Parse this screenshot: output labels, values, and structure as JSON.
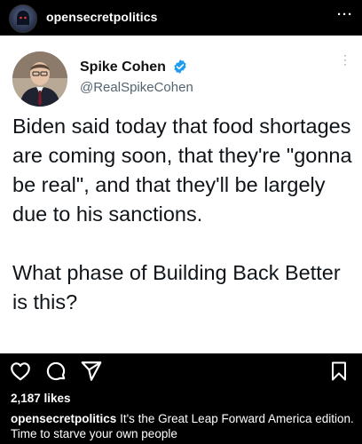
{
  "header": {
    "username": "opensecretpolitics",
    "more_icon": "more-horizontal-icon",
    "more_glyph": "···"
  },
  "tweet": {
    "name": "Spike Cohen",
    "handle": "@RealSpikeCohen",
    "verified_icon": "verified-badge-icon",
    "menu_icon": "more-vertical-icon",
    "menu_glyph": "⋮",
    "text": "Biden said today that food shortages are coming soon, that they're \"gonna be real\", and that they'll be largely due to his sanctions.\n\nWhat phase of Building Back Better is this?"
  },
  "actions": {
    "like_icon": "heart-icon",
    "comment_icon": "comment-icon",
    "share_icon": "share-icon",
    "save_icon": "bookmark-icon"
  },
  "likes": "2,187 likes",
  "caption": {
    "user": "opensecretpolitics",
    "text": "It's the Great Leap Forward America edition. Time to starve your own people"
  },
  "colors": {
    "background": "#000000",
    "post_background": "#ffffff",
    "verified_blue": "#1d9bf0",
    "handle_gray": "#536471"
  }
}
